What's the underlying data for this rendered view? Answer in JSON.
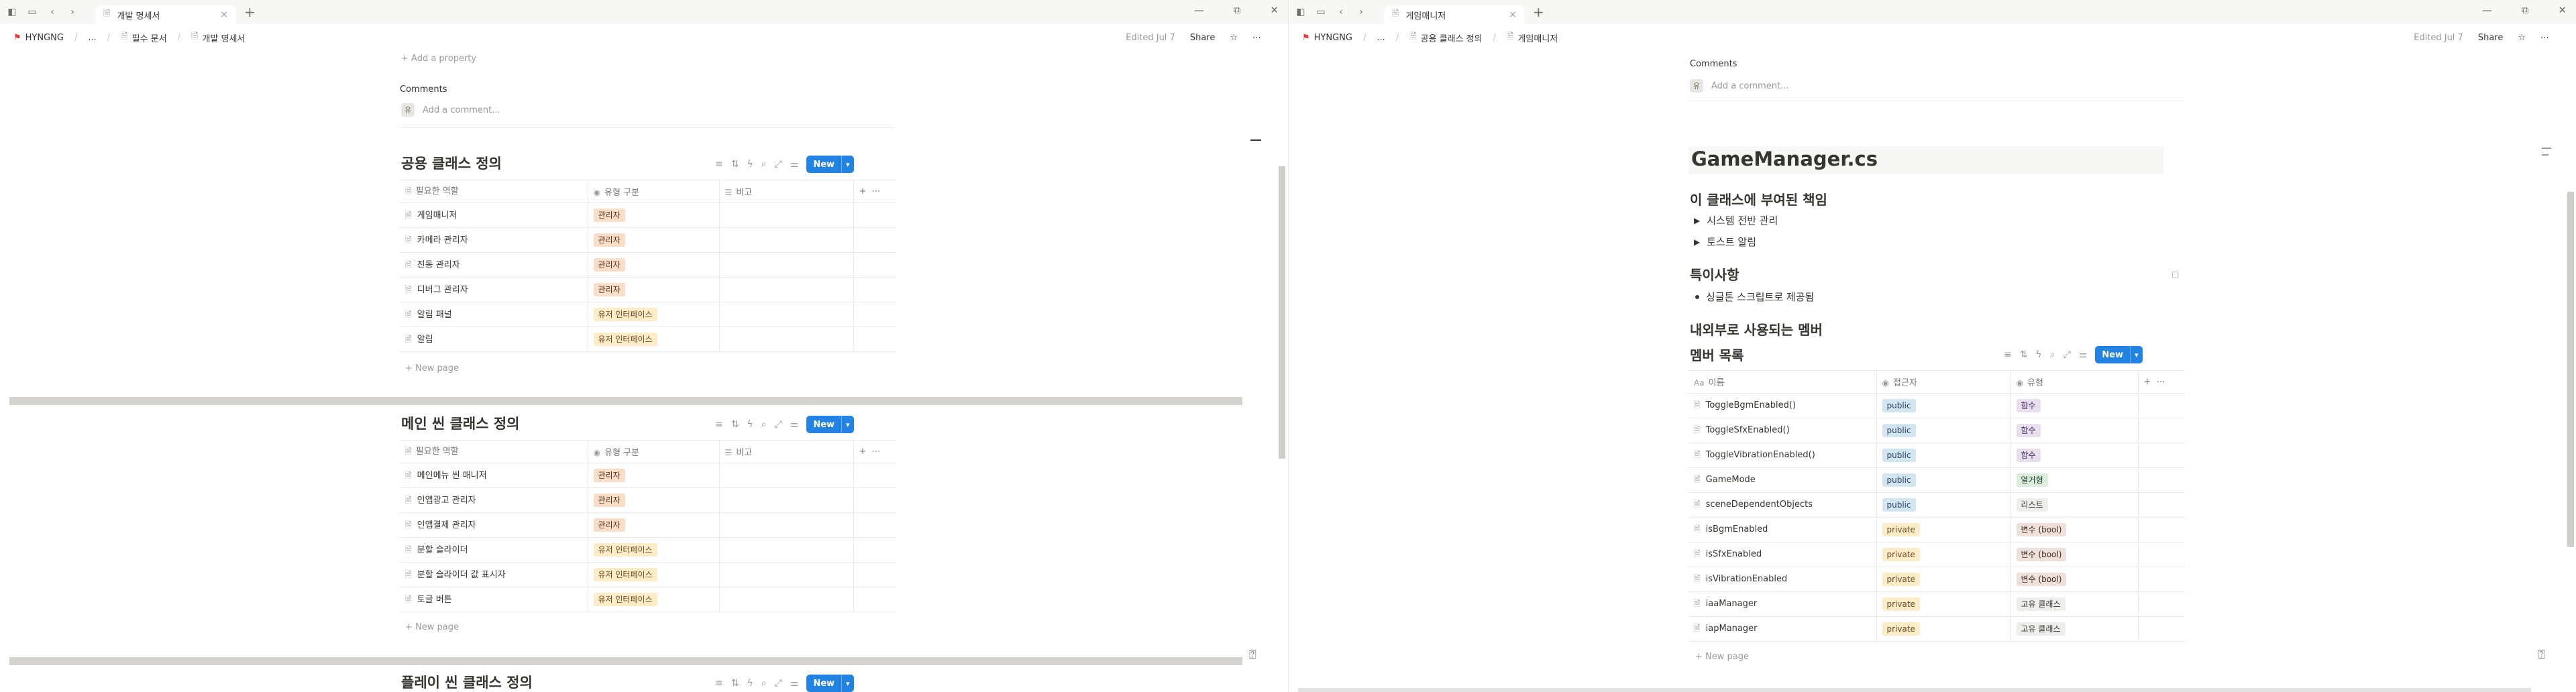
{
  "left": {
    "tab_title": "개발 명세서",
    "breadcrumb": [
      "HYNGNG",
      "...",
      "필수 문서",
      "개발 명세서"
    ],
    "edited": "Edited Jul 7",
    "share": "Share",
    "add_property": "+ Add a property",
    "comments_label": "Comments",
    "comment_placeholder": "Add a comment...",
    "new_button": "New",
    "new_page": "+ New page",
    "db1": {
      "title": "공용 클래스 정의",
      "columns": [
        "필요한 역할",
        "유형 구분",
        "비고"
      ],
      "rows": [
        {
          "name": "게임매니저",
          "type": "관리자"
        },
        {
          "name": "카메라 관리자",
          "type": "관리자"
        },
        {
          "name": "진동 관리자",
          "type": "관리자"
        },
        {
          "name": "디버그 관리자",
          "type": "관리자"
        },
        {
          "name": "알림 패널",
          "type": "유저 인터페이스"
        },
        {
          "name": "알림",
          "type": "유저 인터페이스"
        }
      ]
    },
    "db2": {
      "title": "메인 씬 클래스 정의",
      "columns": [
        "필요한 역할",
        "유형 구분",
        "비고"
      ],
      "rows": [
        {
          "name": "메인메뉴 씬 매니저",
          "type": "관리자"
        },
        {
          "name": "인앱광고 관리자",
          "type": "관리자"
        },
        {
          "name": "인앱결제 관리자",
          "type": "관리자"
        },
        {
          "name": "분할 슬라이더",
          "type": "유저 인터페이스"
        },
        {
          "name": "분할 슬라이더 값 표시자",
          "type": "유저 인터페이스"
        },
        {
          "name": "토글 버튼",
          "type": "유저 인터페이스"
        }
      ]
    },
    "db3": {
      "title": "플레이 씬 클래스 정의"
    }
  },
  "right": {
    "tab_title": "게임매니저",
    "breadcrumb": [
      "HYNGNG",
      "...",
      "공용 클래스 정의",
      "게임매니저"
    ],
    "edited": "Edited Jul 7",
    "share": "Share",
    "comments_label": "Comments",
    "comment_placeholder": "Add a comment...",
    "page_title": "GameManager.cs",
    "h_resp": "이 클래스에 부여된 책임",
    "toggles": [
      "시스템 전반 관리",
      "토스트 알림"
    ],
    "h_special": "특이사항",
    "bullets": [
      "싱글톤 스크립트로 제공됨"
    ],
    "h_members_section": "내외부로 사용되는 멤버",
    "db_title": "멤버 목록",
    "new_button": "New",
    "new_page": "+ New page",
    "columns": [
      "이름",
      "접근자",
      "유형"
    ],
    "rows": [
      {
        "name": "ToggleBgmEnabled()",
        "access": "public",
        "type": "함수"
      },
      {
        "name": "ToggleSfxEnabled()",
        "access": "public",
        "type": "함수"
      },
      {
        "name": "ToggleVibrationEnabled()",
        "access": "public",
        "type": "함수"
      },
      {
        "name": "GameMode",
        "access": "public",
        "type": "열거형"
      },
      {
        "name": "sceneDependentObjects",
        "access": "public",
        "type": "리스트"
      },
      {
        "name": "isBgmEnabled",
        "access": "private",
        "type": "변수 (bool)"
      },
      {
        "name": "isSfxEnabled",
        "access": "private",
        "type": "변수 (bool)"
      },
      {
        "name": "isVibrationEnabled",
        "access": "private",
        "type": "변수 (bool)"
      },
      {
        "name": "iaaManager",
        "access": "private",
        "type": "고유 클래스"
      },
      {
        "name": "iapManager",
        "access": "private",
        "type": "고유 클래스"
      }
    ]
  },
  "tag_colors": {
    "관리자": {
      "bg": "#fadec9",
      "fg": "#5a3321"
    },
    "유저 인터페이스": {
      "bg": "#fdecc8",
      "fg": "#6b4a1f"
    },
    "public": {
      "bg": "#d3e5ef",
      "fg": "#28456c"
    },
    "private": {
      "bg": "#fdecc8",
      "fg": "#6b4a1f"
    },
    "함수": {
      "bg": "#e8deee",
      "fg": "#492f64"
    },
    "열거형": {
      "bg": "#dbeddb",
      "fg": "#1c3829"
    },
    "리스트": {
      "bg": "#eeeeec",
      "fg": "#32302c"
    },
    "변수 (bool)": {
      "bg": "#eee0da",
      "fg": "#442a1e"
    },
    "고유 클래스": {
      "bg": "#eeeeec",
      "fg": "#32302c"
    }
  }
}
